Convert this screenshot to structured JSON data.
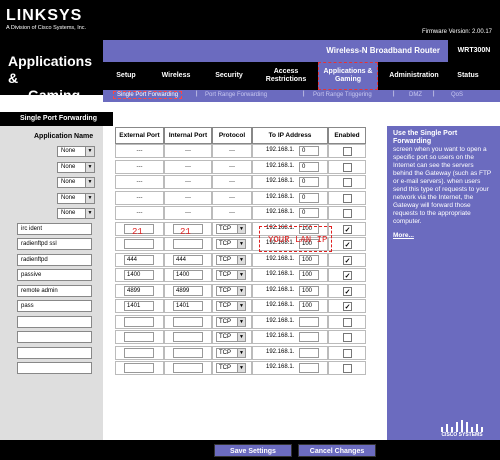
{
  "header": {
    "logo": "LINKSYS",
    "logo_sub": "A Division of Cisco Systems, Inc.",
    "firmware": "Firmware Version: 2.00.17",
    "router_name": "Wireless-N Broadband Router",
    "model": "WRT300N",
    "section_title_line1": "Applications &",
    "section_title_line2": "Gaming"
  },
  "main_nav": [
    {
      "label": "Setup"
    },
    {
      "label": "Wireless"
    },
    {
      "label": "Security"
    },
    {
      "label": "Access Restrictions"
    },
    {
      "label": "Applications & Gaming",
      "active": true
    },
    {
      "label": "Administration"
    },
    {
      "label": "Status"
    }
  ],
  "sub_nav": [
    {
      "label": "Single Port Forwarding",
      "active": true
    },
    {
      "label": "Port Range Forwarding"
    },
    {
      "label": "Port Range Triggering"
    },
    {
      "label": "DMZ"
    },
    {
      "label": "QoS"
    }
  ],
  "page": {
    "section": "Single Port Forwarding",
    "app_name_header": "Application Name"
  },
  "table": {
    "headers": [
      "External Port",
      "Internal Port",
      "Protocol",
      "To IP Address",
      "Enabled"
    ],
    "ip_prefix": "192.168.1.",
    "rows": [
      {
        "app": "None",
        "app_type": "select",
        "ext": "---",
        "int": "---",
        "proto": "---",
        "ip": "0",
        "enabled": false
      },
      {
        "app": "None",
        "app_type": "select",
        "ext": "---",
        "int": "---",
        "proto": "---",
        "ip": "0",
        "enabled": false
      },
      {
        "app": "None",
        "app_type": "select",
        "ext": "---",
        "int": "---",
        "proto": "---",
        "ip": "0",
        "enabled": false
      },
      {
        "app": "None",
        "app_type": "select",
        "ext": "---",
        "int": "---",
        "proto": "---",
        "ip": "0",
        "enabled": false
      },
      {
        "app": "None",
        "app_type": "select",
        "ext": "---",
        "int": "---",
        "proto": "---",
        "ip": "0",
        "enabled": false
      },
      {
        "app": "irc ident",
        "app_type": "input",
        "ext": "",
        "int": "",
        "proto": "TCP",
        "ip": "100",
        "enabled": true
      },
      {
        "app": "radienftpd ssl",
        "app_type": "input",
        "ext": "",
        "int": "",
        "proto": "TCP",
        "ip": "100",
        "enabled": true
      },
      {
        "app": "radienftpd",
        "app_type": "input",
        "ext": "444",
        "int": "444",
        "proto": "TCP",
        "ip": "100",
        "enabled": true
      },
      {
        "app": "passive",
        "app_type": "input",
        "ext": "1400",
        "int": "1400",
        "proto": "TCP",
        "ip": "100",
        "enabled": true
      },
      {
        "app": "remote admin",
        "app_type": "input",
        "ext": "4899",
        "int": "4899",
        "proto": "TCP",
        "ip": "100",
        "enabled": true
      },
      {
        "app": "pass",
        "app_type": "input",
        "ext": "1401",
        "int": "1401",
        "proto": "TCP",
        "ip": "100",
        "enabled": true
      },
      {
        "app": "",
        "app_type": "input",
        "ext": "",
        "int": "",
        "proto": "TCP",
        "ip": "",
        "enabled": false
      },
      {
        "app": "",
        "app_type": "input",
        "ext": "",
        "int": "",
        "proto": "TCP",
        "ip": "",
        "enabled": false
      },
      {
        "app": "",
        "app_type": "input",
        "ext": "",
        "int": "",
        "proto": "TCP",
        "ip": "",
        "enabled": false
      },
      {
        "app": "",
        "app_type": "input",
        "ext": "",
        "int": "",
        "proto": "TCP",
        "ip": "",
        "enabled": false
      }
    ]
  },
  "annotations": {
    "ext_port": "21",
    "int_port": "21",
    "lan_ip": "YOUR LAN IP"
  },
  "help": {
    "title": "Use the Single Port Forwarding",
    "body": "screen when you want to open a specific port so users on the Internet can see the servers behind the Gateway (such as FTP or e-mail servers). when users send this type of requests to your network via the Internet, the Gateway will forward those requests to the appropriate computer.",
    "more": "More...",
    "brand": "CISCO SYSTEMS"
  },
  "buttons": {
    "save": "Save Settings",
    "cancel": "Cancel Changes"
  },
  "colors": {
    "accent": "#6b6bbf",
    "annotation": "#e02020"
  }
}
